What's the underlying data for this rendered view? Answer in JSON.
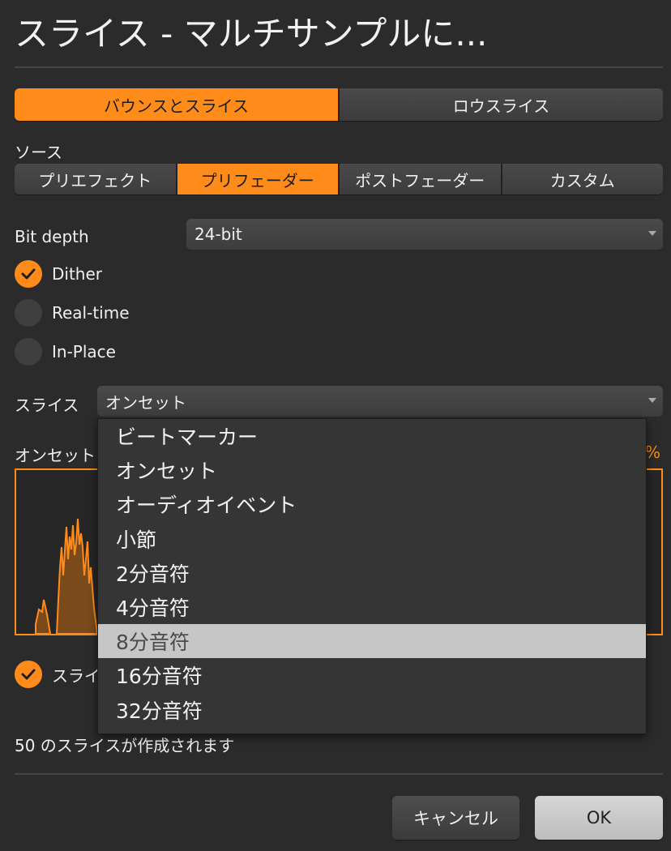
{
  "dialog": {
    "title": "スライス - マルチサンプルに..."
  },
  "mode_tabs": [
    {
      "label": "バウンスとスライス",
      "active": true
    },
    {
      "label": "ロウスライス",
      "active": false
    }
  ],
  "source": {
    "label": "ソース",
    "options": [
      {
        "label": "プリエフェクト",
        "active": false
      },
      {
        "label": "プリフェーダー",
        "active": true
      },
      {
        "label": "ポストフェーダー",
        "active": false
      },
      {
        "label": "カスタム",
        "active": false
      }
    ]
  },
  "bit_depth": {
    "label": "Bit depth",
    "value": "24-bit"
  },
  "checkboxes": {
    "dither": {
      "label": "Dither",
      "checked": true
    },
    "realtime": {
      "label": "Real-time",
      "checked": false
    },
    "inplace": {
      "label": "In-Place",
      "checked": false
    }
  },
  "slice": {
    "label": "スライス",
    "value": "オンセット",
    "options": [
      "ビートマーカー",
      "オンセット",
      "オーディオイベント",
      "小節",
      "2分音符",
      "4分音符",
      "8分音符",
      "16分音符",
      "32分音符"
    ],
    "highlighted": "8分音符"
  },
  "onset": {
    "label_partial": "オンセット",
    "percent_partial": "%"
  },
  "slice_check": {
    "label_partial": "スライ",
    "checked": true
  },
  "status": "50 のスライスが作成されます",
  "buttons": {
    "cancel": "キャンセル",
    "ok": "OK"
  },
  "colors": {
    "accent": "#ff8c1a",
    "background": "#2b2b2b"
  }
}
